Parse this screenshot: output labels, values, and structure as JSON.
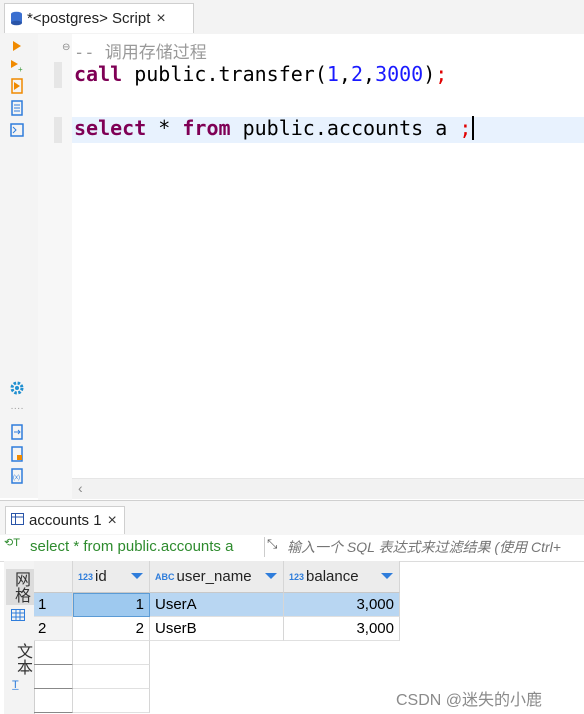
{
  "editor_tab": {
    "label": "*<postgres> Script",
    "close": "×"
  },
  "code": {
    "comment_dashes": "--",
    "comment_text": "调用存储过程",
    "line2": {
      "kw": "call",
      "pre": " public.transfer(",
      "n1": "1",
      "c1": ",",
      "n2": "2",
      "c2": ",",
      "n3": "3000",
      "post": ")",
      "semi": ";"
    },
    "line4": {
      "kw1": "select",
      "mid1": " * ",
      "kw2": "from",
      "mid2": " public.accounts a ",
      "semi": ";"
    }
  },
  "results_tab": {
    "label": "accounts 1",
    "close": "×"
  },
  "filter": {
    "query": "select * from public.accounts a",
    "placeholder": "输入一个 SQL 表达式来过滤结果 (使用 Ctrl+"
  },
  "side_tabs": {
    "grid": "网格",
    "text": "文本"
  },
  "grid": {
    "columns": [
      {
        "name": "id",
        "type": "123"
      },
      {
        "name": "user_name",
        "type": "ABC"
      },
      {
        "name": "balance",
        "type": "123"
      }
    ],
    "rows": [
      {
        "num": "1",
        "id": "1",
        "user_name": "UserA",
        "balance": "3,000"
      },
      {
        "num": "2",
        "id": "2",
        "user_name": "UserB",
        "balance": "3,000"
      }
    ]
  },
  "watermark": "CSDN @迷失的小鹿",
  "colors": {
    "keyword": "#7f0055",
    "number": "#1a1aff",
    "semicolon": "#e00000",
    "selection": "#b8d6f2",
    "query_text": "#2e8b2e"
  }
}
